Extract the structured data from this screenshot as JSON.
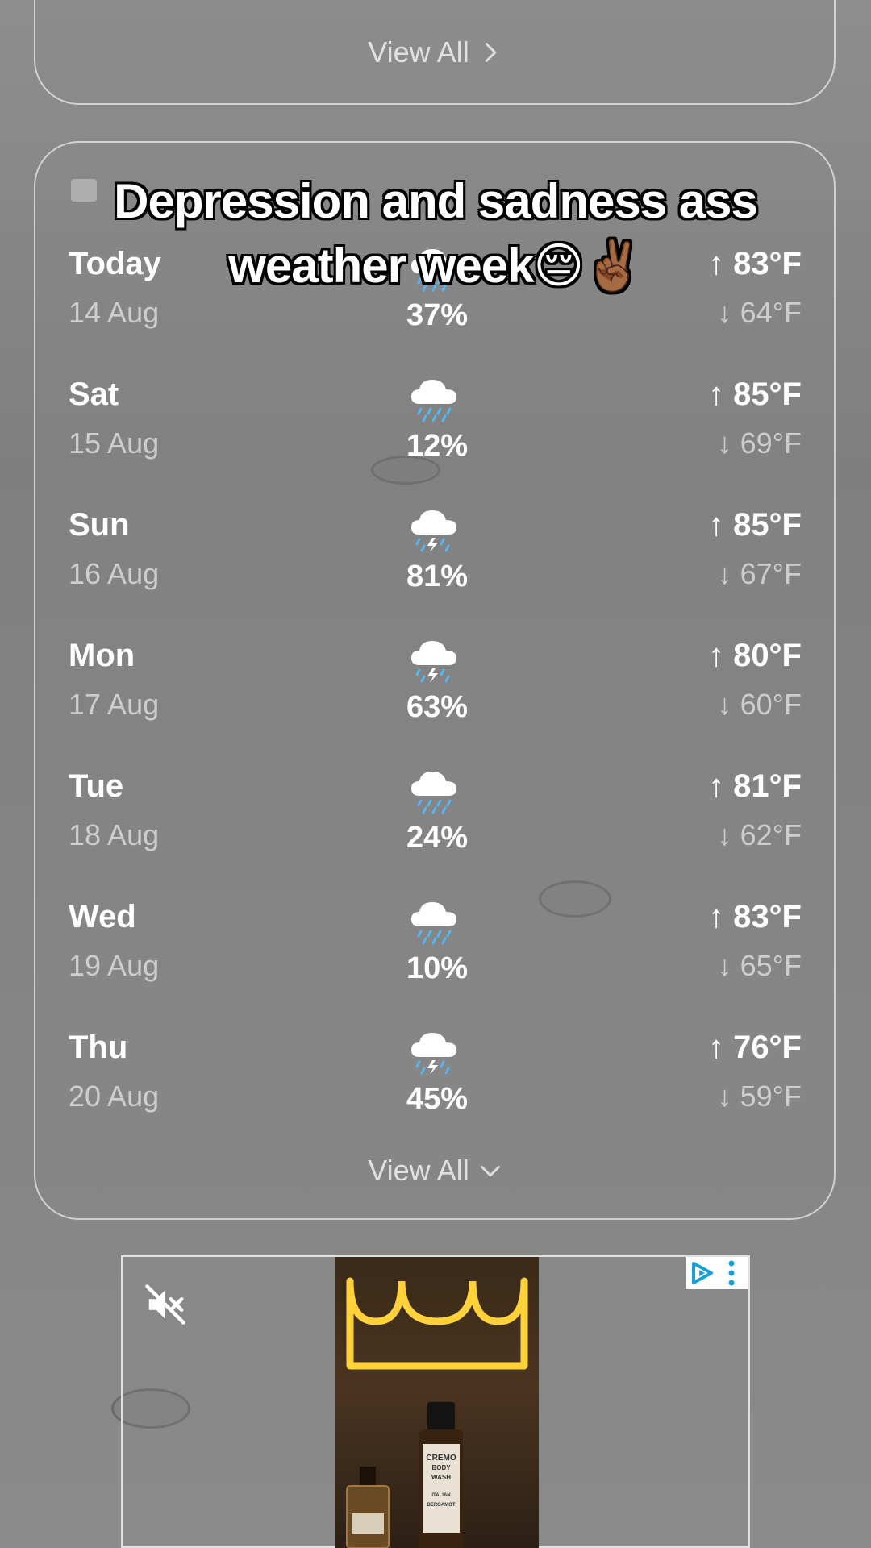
{
  "top_card": {
    "view_all_label": "View All"
  },
  "caption": {
    "text": "Depression and sadness ass weather week😔✌🏾"
  },
  "forecast": {
    "days": [
      {
        "name": "Today",
        "date": "14 Aug",
        "icon": "rain-cloud-icon",
        "precip": "37%",
        "high": "↑ 83°F",
        "low": "↓ 64°F"
      },
      {
        "name": "Sat",
        "date": "15 Aug",
        "icon": "rain-cloud-icon",
        "precip": "12%",
        "high": "↑ 85°F",
        "low": "↓ 69°F"
      },
      {
        "name": "Sun",
        "date": "16 Aug",
        "icon": "thunderstorm-icon",
        "precip": "81%",
        "high": "↑ 85°F",
        "low": "↓ 67°F"
      },
      {
        "name": "Mon",
        "date": "17 Aug",
        "icon": "thunderstorm-icon",
        "precip": "63%",
        "high": "↑ 80°F",
        "low": "↓ 60°F"
      },
      {
        "name": "Tue",
        "date": "18 Aug",
        "icon": "rain-cloud-icon",
        "precip": "24%",
        "high": "↑ 81°F",
        "low": "↓ 62°F"
      },
      {
        "name": "Wed",
        "date": "19 Aug",
        "icon": "rain-cloud-icon",
        "precip": "10%",
        "high": "↑ 83°F",
        "low": "↓ 65°F"
      },
      {
        "name": "Thu",
        "date": "20 Aug",
        "icon": "thunderstorm-icon",
        "precip": "45%",
        "high": "↑ 76°F",
        "low": "↓ 59°F"
      }
    ],
    "view_all_label": "View All"
  },
  "ad": {
    "brand": "CREMO",
    "product_line1": "BODY",
    "product_line2": "WASH",
    "scent1": "ITALIAN",
    "scent2": "BERGAMOT",
    "icons": [
      "mute-icon",
      "adchoices-icon",
      "more-options-icon"
    ]
  },
  "colors": {
    "precip_blue": "#5ab4f0",
    "bolt": "#ffffff",
    "neon": "#ffd23a"
  }
}
